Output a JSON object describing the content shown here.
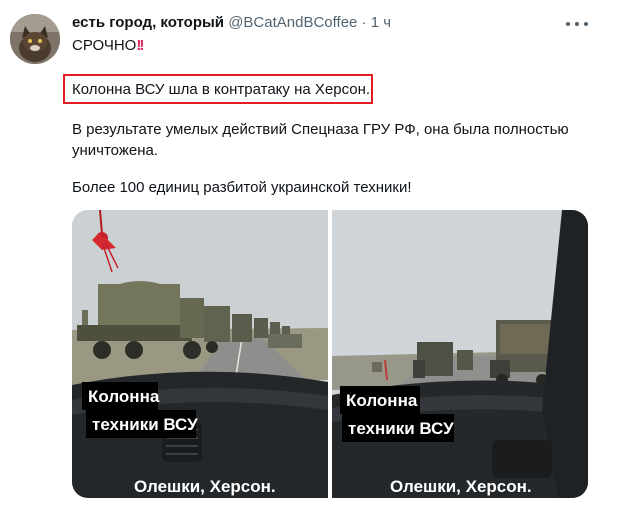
{
  "tweet": {
    "author_name": "есть город, который",
    "handle": "@BCatAndBCoffee",
    "separator": "·",
    "time": "1 ч",
    "urgent_label": "СРОЧНО",
    "urgent_marks": "!!",
    "highlighted_line": "Колонна ВСУ шла в контратаку на Херсон.",
    "paragraph_line1": "В результате умелых действий Спецназа ГРУ РФ, она была полностью",
    "paragraph_line2": "уничтожена.",
    "summary_line": "Более 100 единиц разбитой украинской техники!"
  },
  "media": {
    "left_caption_line1": "Колонна",
    "left_caption_line2": "техники ВСУ",
    "left_location": "Олешки,  Херсон.",
    "right_caption_line1": "Колонна",
    "right_caption_line2": "техники ВСУ",
    "right_location": "Олешки,  Херсон."
  },
  "colors": {
    "highlight_border": "#e31b23",
    "secondary_text": "#536471",
    "urgent_marks": "#e0245e"
  },
  "icons": [
    "cat-avatar",
    "more-options-icon",
    "tassel-ornament"
  ]
}
